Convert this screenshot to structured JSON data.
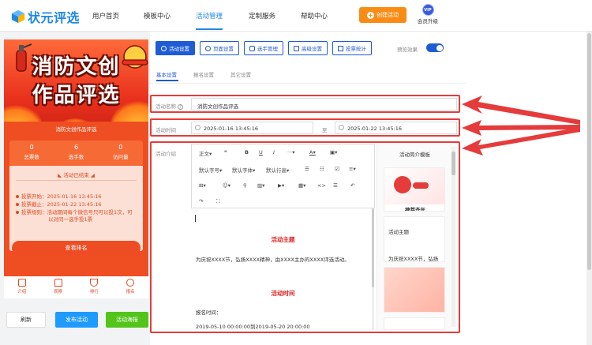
{
  "header": {
    "logo_text": "状元评选",
    "nav": [
      "用户首页",
      "模板中心",
      "活动管理",
      "定制服务",
      "帮助中心"
    ],
    "create_button": "创建活动",
    "vip_badge": "VIP",
    "vip_label": "会员升级"
  },
  "preview": {
    "poster_line1": "消防文创",
    "poster_line2": "作品评选",
    "title": "消防文创作品评选",
    "stats": [
      {
        "value": "0",
        "label": "总票数"
      },
      {
        "value": "6",
        "label": "选手数"
      },
      {
        "value": "0",
        "label": "访问量"
      }
    ],
    "ended": "活动已结束",
    "vote_start": "投票开始：2025-01-16 13:45:16",
    "vote_end": "投票截止：2025-01-22 13:45:16",
    "rule_line1": "投票规则：活动期间每个微信号只可以投1次，可",
    "rule_line2": "以对同一选手投1票",
    "rank_button": "查看排名",
    "bottom_nav": [
      "介绍",
      "观察",
      "排行",
      "报名"
    ]
  },
  "actions": {
    "refresh": "刷新",
    "publish": "发布活动",
    "poster": "活动海报"
  },
  "toolbar": {
    "buttons": [
      "活动设置",
      "页面设置",
      "选手管理",
      "高级设置",
      "投票统计"
    ],
    "preview_effect": "预览效果"
  },
  "subtabs": [
    "基本设置",
    "报名设置",
    "其它设置"
  ],
  "form": {
    "name_label": "活动名称",
    "name_value": "消防文创作品评选",
    "time_label": "活动时间",
    "start_time": "2025-01-16 13:45:16",
    "to": "至",
    "end_time": "2025-01-22 13:45:16",
    "intro_label": "活动介绍"
  },
  "editor": {
    "row1": [
      "正文",
      "❝",
      "B",
      "U",
      "I",
      "···",
      "A",
      "▣"
    ],
    "row2": [
      "默认字号",
      "默认字体",
      "默认行高",
      "☰",
      "☷",
      "☑",
      "≡"
    ],
    "row3": [
      "⊞",
      "☺",
      "⚲",
      "▨",
      "▶",
      "▦",
      "<>",
      "☰",
      "↶"
    ],
    "row4": [
      "↷",
      "⛶"
    ],
    "heading1": "活动主题",
    "para1": "为庆祝XXXX节，弘扬XXXX精神，由XXXX主办的XXXX评选活动。",
    "heading2": "活动时间",
    "para2": "报名时间：",
    "para3": "2019-05-10 00:00:00到2019-05-20 20:00:00"
  },
  "templates": {
    "title": "活动简介模板",
    "card1_text": "捷菩齐年",
    "card2_heading": "活动主题",
    "card2_text": "为庆祝XXXX节，弘扬"
  },
  "colors": {
    "brand": "#1e5bd6",
    "highlight": "#e63b3b",
    "poster_red": "#e8301c",
    "create_orange": "#fa8c16",
    "publish_blue": "#1e9bff",
    "poster_green": "#52c41a"
  }
}
